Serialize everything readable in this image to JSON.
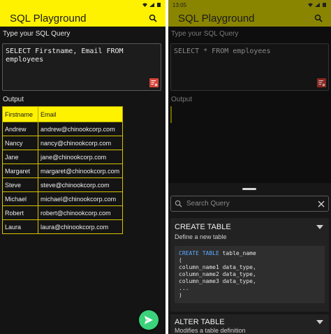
{
  "left": {
    "status": {
      "time": ""
    },
    "appbar": {
      "title": "SQL Playground"
    },
    "query_label": "Type your SQL Query",
    "query_text": "SELECT Firstname, Email FROM\nemployees",
    "output_label": "Output",
    "table": {
      "headers": [
        "Firstname",
        "Email"
      ],
      "rows": [
        [
          "Andrew",
          "andrew@chinookcorp.com"
        ],
        [
          "Nancy",
          "nancy@chinookcorp.com"
        ],
        [
          "Jane",
          "jane@chinookcorp.com"
        ],
        [
          "Margaret",
          "margaret@chinookcorp.com"
        ],
        [
          "Steve",
          "steve@chinookcorp.com"
        ],
        [
          "Michael",
          "michael@chinookcorp.com"
        ],
        [
          "Robert",
          "robert@chinookcorp.com"
        ],
        [
          "Laura",
          "laura@chinookcorp.com"
        ]
      ]
    },
    "fab_icon": "send-icon"
  },
  "right": {
    "status": {
      "time": "13:05"
    },
    "appbar": {
      "title": "SQL Playground"
    },
    "query_label": "Type your SQL Query",
    "query_text": "SELECT * FROM employees",
    "output_label": "Output",
    "sheet": {
      "search_placeholder": "Search Query",
      "cards": [
        {
          "title": "CREATE TABLE",
          "subtitle": "Define a new table",
          "code_keyword": "CREATE TABLE",
          "code_first_rest": " table_name",
          "code_rest": "(\ncolumn_name1 data_type,\ncolumn_name2 data_type,\ncolumn_name3 data_type,\n...\n)"
        },
        {
          "title": "ALTER TABLE",
          "subtitle": "Modifies a table definition"
        }
      ]
    }
  },
  "colors": {
    "accent": "#fff200",
    "fab": "#3ad27a",
    "keyword": "#5aa9ff"
  }
}
